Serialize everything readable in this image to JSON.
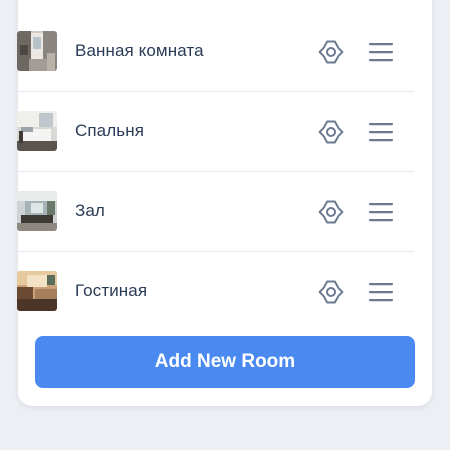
{
  "rooms": [
    {
      "name": "Ванная комната",
      "thumbnail": "bathroom-photo"
    },
    {
      "name": "Спальня",
      "thumbnail": "bedroom-photo"
    },
    {
      "name": "Зал",
      "thumbnail": "hall-photo"
    },
    {
      "name": "Гостиная",
      "thumbnail": "living-room-photo"
    }
  ],
  "icons": {
    "settings": "gear-icon",
    "reorder": "drag-handle-icon"
  },
  "add_button": {
    "label": "Add New Room"
  },
  "colors": {
    "accent": "#4a8af0",
    "text": "#2a3b55",
    "icon": "#6b7a90",
    "background": "#eceff3",
    "card": "#ffffff"
  }
}
